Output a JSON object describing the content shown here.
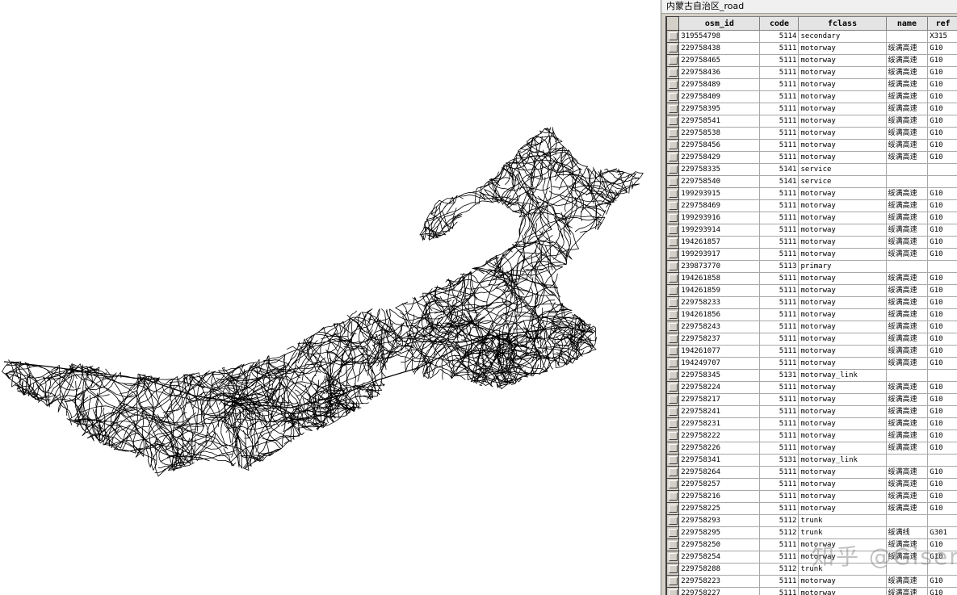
{
  "window": {
    "title": "内蒙古自治区_road"
  },
  "table": {
    "columns": [
      "osm_id",
      "code",
      "fclass",
      "name",
      "ref"
    ],
    "rows": [
      [
        "319554798",
        "5114",
        "secondary",
        "",
        "X315"
      ],
      [
        "229758438",
        "5111",
        "motorway",
        "绥满高速",
        "G10"
      ],
      [
        "229758465",
        "5111",
        "motorway",
        "绥满高速",
        "G10"
      ],
      [
        "229758436",
        "5111",
        "motorway",
        "绥满高速",
        "G10"
      ],
      [
        "229758489",
        "5111",
        "motorway",
        "绥满高速",
        "G10"
      ],
      [
        "229758409",
        "5111",
        "motorway",
        "绥满高速",
        "G10"
      ],
      [
        "229758395",
        "5111",
        "motorway",
        "绥满高速",
        "G10"
      ],
      [
        "229758541",
        "5111",
        "motorway",
        "绥满高速",
        "G10"
      ],
      [
        "229758538",
        "5111",
        "motorway",
        "绥满高速",
        "G10"
      ],
      [
        "229758456",
        "5111",
        "motorway",
        "绥满高速",
        "G10"
      ],
      [
        "229758429",
        "5111",
        "motorway",
        "绥满高速",
        "G10"
      ],
      [
        "229758335",
        "5141",
        "service",
        "",
        ""
      ],
      [
        "229758540",
        "5141",
        "service",
        "",
        ""
      ],
      [
        "199293915",
        "5111",
        "motorway",
        "绥满高速",
        "G10"
      ],
      [
        "229758469",
        "5111",
        "motorway",
        "绥满高速",
        "G10"
      ],
      [
        "199293916",
        "5111",
        "motorway",
        "绥满高速",
        "G10"
      ],
      [
        "199293914",
        "5111",
        "motorway",
        "绥满高速",
        "G10"
      ],
      [
        "194261857",
        "5111",
        "motorway",
        "绥满高速",
        "G10"
      ],
      [
        "199293917",
        "5111",
        "motorway",
        "绥满高速",
        "G10"
      ],
      [
        "239873770",
        "5113",
        "primary",
        "",
        ""
      ],
      [
        "194261858",
        "5111",
        "motorway",
        "绥满高速",
        "G10"
      ],
      [
        "194261859",
        "5111",
        "motorway",
        "绥满高速",
        "G10"
      ],
      [
        "229758233",
        "5111",
        "motorway",
        "绥满高速",
        "G10"
      ],
      [
        "194261856",
        "5111",
        "motorway",
        "绥满高速",
        "G10"
      ],
      [
        "229758243",
        "5111",
        "motorway",
        "绥满高速",
        "G10"
      ],
      [
        "229758237",
        "5111",
        "motorway",
        "绥满高速",
        "G10"
      ],
      [
        "194261077",
        "5111",
        "motorway",
        "绥满高速",
        "G10"
      ],
      [
        "194249707",
        "5111",
        "motorway",
        "绥满高速",
        "G10"
      ],
      [
        "229758345",
        "5131",
        "motorway_link",
        "",
        ""
      ],
      [
        "229758224",
        "5111",
        "motorway",
        "绥满高速",
        "G10"
      ],
      [
        "229758217",
        "5111",
        "motorway",
        "绥满高速",
        "G10"
      ],
      [
        "229758241",
        "5111",
        "motorway",
        "绥满高速",
        "G10"
      ],
      [
        "229758231",
        "5111",
        "motorway",
        "绥满高速",
        "G10"
      ],
      [
        "229758222",
        "5111",
        "motorway",
        "绥满高速",
        "G10"
      ],
      [
        "229758226",
        "5111",
        "motorway",
        "绥满高速",
        "G10"
      ],
      [
        "229758341",
        "5131",
        "motorway_link",
        "",
        ""
      ],
      [
        "229758264",
        "5111",
        "motorway",
        "绥满高速",
        "G10"
      ],
      [
        "229758257",
        "5111",
        "motorway",
        "绥满高速",
        "G10"
      ],
      [
        "229758216",
        "5111",
        "motorway",
        "绥满高速",
        "G10"
      ],
      [
        "229758225",
        "5111",
        "motorway",
        "绥满高速",
        "G10"
      ],
      [
        "229758293",
        "5112",
        "trunk",
        "",
        ""
      ],
      [
        "229758295",
        "5112",
        "trunk",
        "绥满线",
        "G301"
      ],
      [
        "229758250",
        "5111",
        "motorway",
        "绥满高速",
        "G10"
      ],
      [
        "229758254",
        "5111",
        "motorway",
        "绥满高速",
        "G10"
      ],
      [
        "229758288",
        "5112",
        "trunk",
        "",
        ""
      ],
      [
        "229758223",
        "5111",
        "motorway",
        "绥满高速",
        "G10"
      ],
      [
        "229758227",
        "5111",
        "motorway",
        "绥满高速",
        "G10"
      ]
    ]
  },
  "watermark": "知乎 @Giser",
  "colors": {
    "road": "#000000",
    "panel": "#d4d0c8",
    "header": "#e4e4e4"
  }
}
